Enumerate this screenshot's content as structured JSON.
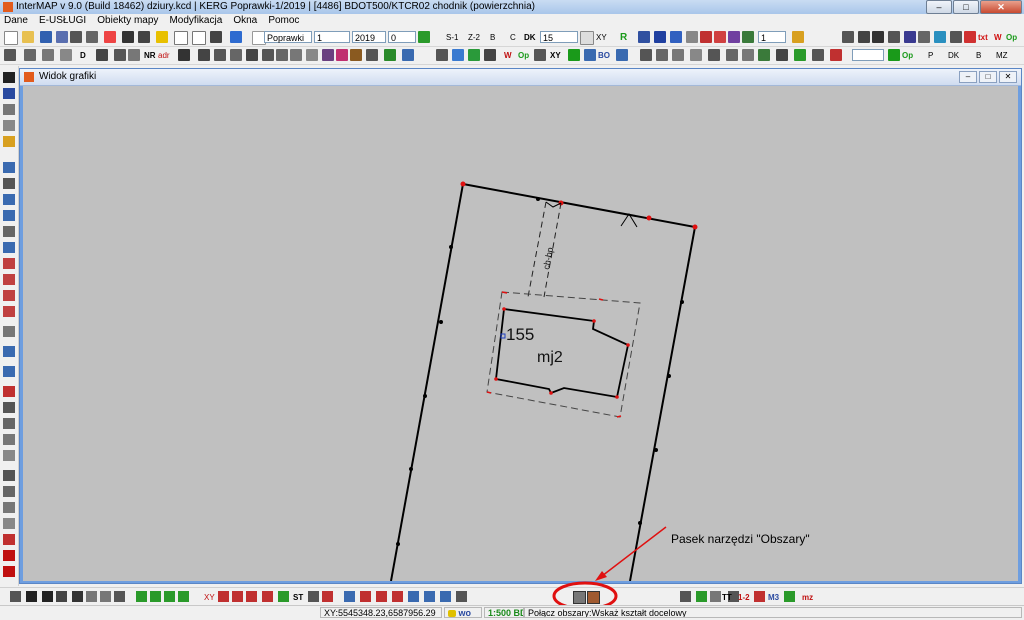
{
  "window": {
    "title": "InterMAP v 9.0 (Build 18462)   dziury.kcd | KERG Poprawki-1/2019 | [4486] BDOT500/KTCR02 chodnik (powierzchnia)",
    "minimize": "–",
    "maximize": "□",
    "close": "✕"
  },
  "menu": [
    "Dane",
    "E-USŁUGI",
    "Obiekty mapy",
    "Modyfikacja",
    "Okna",
    "Pomoc"
  ],
  "toolbar1": {
    "kerg_field": "Poprawki",
    "number_field": "1",
    "year_field": "2019",
    "zero_field": "0",
    "labels": [
      "S-1",
      "Z-2",
      "B",
      "C",
      "DK",
      "XY",
      "R"
    ],
    "scale_field": "15",
    "right_labels": [
      "txt",
      "W",
      "Op"
    ],
    "right_field": "1"
  },
  "toolbar2": {
    "labels": [
      "D",
      "NR",
      "adr",
      "W",
      "Op",
      "XY",
      "BO"
    ],
    "right_labels": [
      "Op",
      "P",
      "DK",
      "B",
      "MZ"
    ]
  },
  "subwindow": {
    "title": "Widok grafiki",
    "minimize": "–",
    "maximize": "□",
    "close": "✕"
  },
  "map": {
    "parcel_number": "155",
    "building_label": "mj2",
    "sidewalk_label": "ch-bp"
  },
  "annotation": "Pasek narzędzi \"Obszary\"",
  "bottom_toolbar": {
    "labels": [
      "XY",
      "ST",
      "TT",
      "1-2",
      "M3",
      "mz"
    ]
  },
  "status": {
    "coordinates": "XY:5545348.23,6587956.29",
    "layer": "wo",
    "scale": "1:500 BD",
    "message": "Połącz obszary:Wskaż kształt docelowy"
  },
  "colors": {
    "accent_red": "#e01010",
    "canvas_bg": "#c0c0c0",
    "green": "#1a9a1a"
  }
}
